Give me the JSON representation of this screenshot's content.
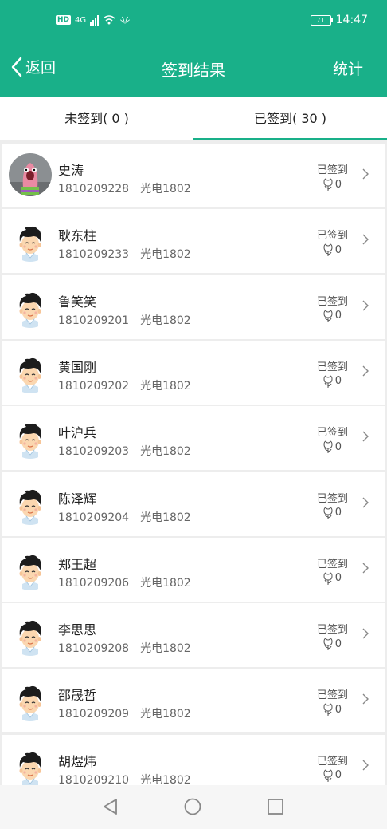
{
  "status_bar": {
    "network": "4G",
    "battery": "71",
    "time": "14:47"
  },
  "header": {
    "back_label": "返回",
    "title": "签到结果",
    "stats_label": "统计"
  },
  "tabs": [
    {
      "label": "未签到( 0 )",
      "active": false
    },
    {
      "label": "已签到( 30 )",
      "active": true
    }
  ],
  "students": [
    {
      "name": "史涛",
      "id": "1810209228",
      "class": "光电1802",
      "status": "已签到",
      "likes": "0",
      "avatar": "photo"
    },
    {
      "name": "耿东柱",
      "id": "1810209233",
      "class": "光电1802",
      "status": "已签到",
      "likes": "0",
      "avatar": "cartoon-boy"
    },
    {
      "name": "鲁笑笑",
      "id": "1810209201",
      "class": "光电1802",
      "status": "已签到",
      "likes": "0",
      "avatar": "cartoon-boy"
    },
    {
      "name": "黄国刚",
      "id": "1810209202",
      "class": "光电1802",
      "status": "已签到",
      "likes": "0",
      "avatar": "cartoon-boy"
    },
    {
      "name": "叶沪兵",
      "id": "1810209203",
      "class": "光电1802",
      "status": "已签到",
      "likes": "0",
      "avatar": "cartoon-boy"
    },
    {
      "name": "陈泽辉",
      "id": "1810209204",
      "class": "光电1802",
      "status": "已签到",
      "likes": "0",
      "avatar": "cartoon-boy"
    },
    {
      "name": "郑王超",
      "id": "1810209206",
      "class": "光电1802",
      "status": "已签到",
      "likes": "0",
      "avatar": "cartoon-boy"
    },
    {
      "name": "李思思",
      "id": "1810209208",
      "class": "光电1802",
      "status": "已签到",
      "likes": "0",
      "avatar": "cartoon-boy"
    },
    {
      "name": "邵晟哲",
      "id": "1810209209",
      "class": "光电1802",
      "status": "已签到",
      "likes": "0",
      "avatar": "cartoon-boy"
    },
    {
      "name": "胡煜炜",
      "id": "1810209210",
      "class": "光电1802",
      "status": "已签到",
      "likes": "0",
      "avatar": "cartoon-boy"
    }
  ],
  "colors": {
    "accent": "#19b089",
    "background": "#ededed"
  },
  "icons": {
    "back": "chevron-left-icon",
    "like": "flower-icon",
    "row_arrow": "chevron-right-icon",
    "nav_back": "triangle-back-icon",
    "nav_home": "circle-home-icon",
    "nav_recent": "square-recent-icon"
  }
}
